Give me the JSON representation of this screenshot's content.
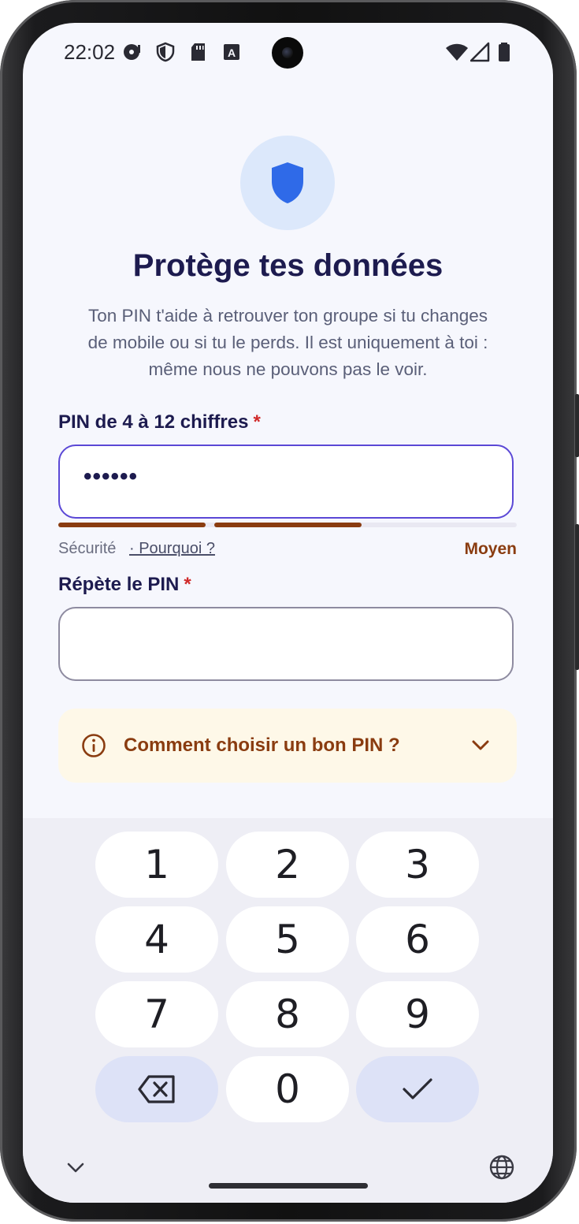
{
  "status_bar": {
    "time": "22:02",
    "icons": [
      "media-icon",
      "shield-status-icon",
      "sd-card-icon",
      "a-box-icon"
    ],
    "right_icons": [
      "wifi-icon",
      "signal-icon",
      "battery-icon"
    ]
  },
  "header": {
    "icon": "shield-icon",
    "title": "Protège tes données",
    "subtitle_lines": [
      "Ton PIN t'aide à retrouver ton groupe si tu changes",
      "de mobile ou si tu le perds. Il est uniquement à toi :",
      "même nous ne pouvons pas le voir."
    ]
  },
  "pin_field": {
    "label": "PIN de 4 à 12 chiffres",
    "required_mark": "*",
    "value_masked": "••••••"
  },
  "strength": {
    "label": "Sécurité",
    "link": "· Pourquoi ?",
    "level_text": "Moyen",
    "level_fraction": 0.66,
    "color": "#8a3c10"
  },
  "repeat_field": {
    "label": "Répète le PIN",
    "required_mark": "*",
    "value": ""
  },
  "tips": {
    "icon": "info-icon",
    "text": "Comment choisir un bon PIN ?",
    "chevron": "chevron-down-icon"
  },
  "keypad": {
    "keys": [
      "1",
      "2",
      "3",
      "4",
      "5",
      "6",
      "7",
      "8",
      "9"
    ],
    "zero": "0",
    "backspace_icon": "backspace-icon",
    "confirm_icon": "check-icon"
  },
  "nav": {
    "collapse_icon": "chevron-down-icon",
    "language_icon": "globe-icon"
  },
  "colors": {
    "accent": "#5b48d6",
    "title": "#1d1b4f",
    "shield": "#2f6ae8",
    "warning": "#8a3c10",
    "required": "#d02a2a"
  }
}
